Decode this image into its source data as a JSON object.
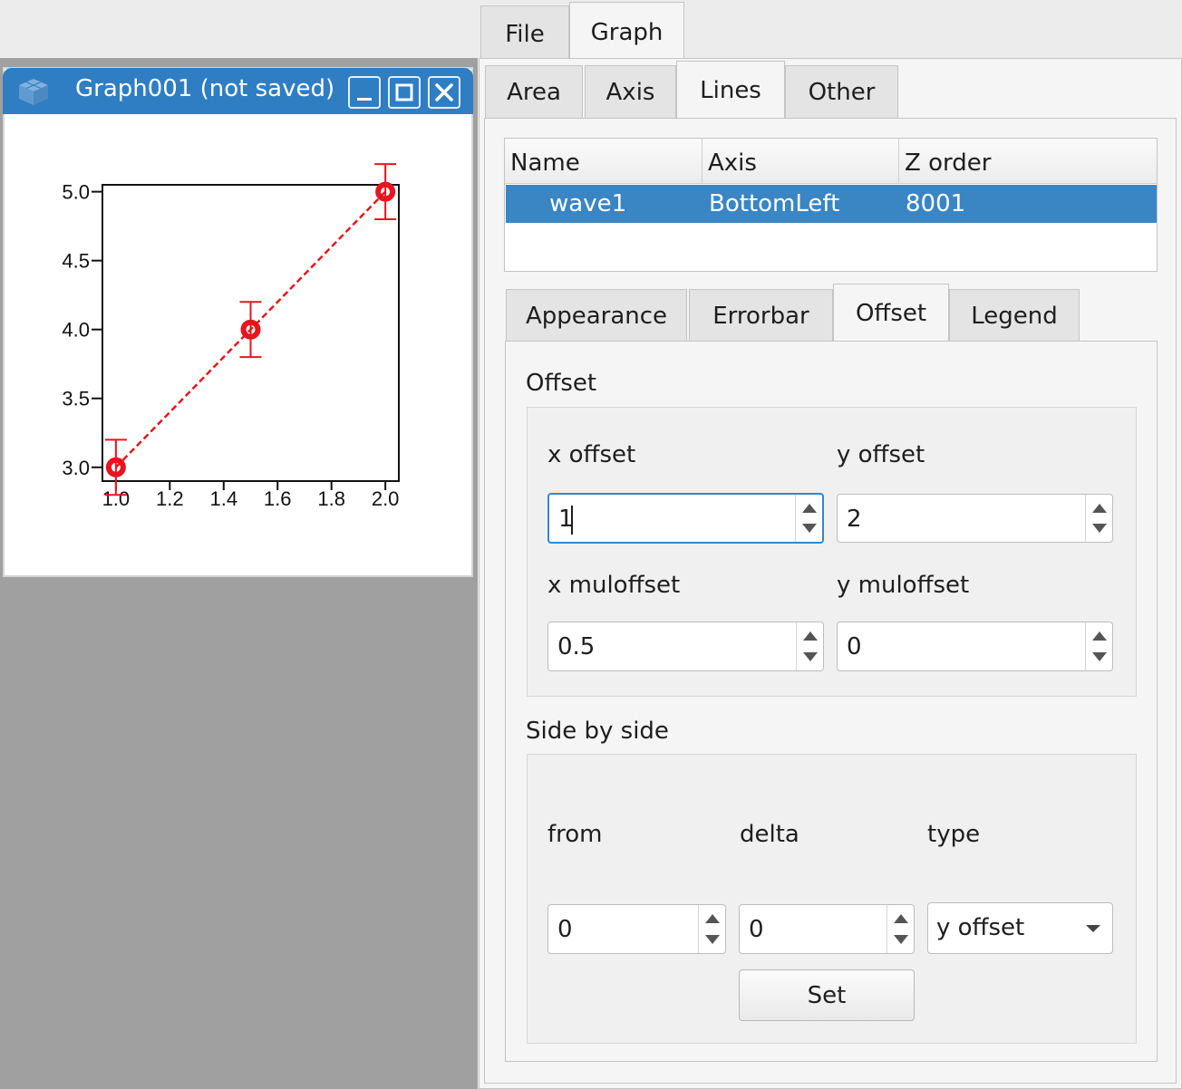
{
  "menu_tabs": [
    "File",
    "Graph"
  ],
  "graph_window": {
    "title": "Graph001 (not saved)",
    "icons": [
      "cube-icon",
      "minimize-icon",
      "maximize-icon",
      "close-icon"
    ]
  },
  "chart_data": {
    "type": "line",
    "title": "",
    "xlabel": "",
    "ylabel": "",
    "xlim": [
      0.95,
      2.05
    ],
    "ylim": [
      2.9,
      5.05
    ],
    "xticks": [
      "1.0",
      "1.2",
      "1.4",
      "1.6",
      "1.8",
      "2.0"
    ],
    "yticks": [
      "3.0",
      "3.5",
      "4.0",
      "4.5",
      "5.0"
    ],
    "series": [
      {
        "x": [
          1.0,
          1.5,
          2.0
        ],
        "y": [
          3.0,
          4.0,
          5.0
        ],
        "yerr": [
          0.2,
          0.2,
          0.2
        ],
        "color": "#e8141e",
        "line_style": "dashed",
        "marker": "circle"
      }
    ]
  },
  "graph_tabs": [
    "Area",
    "Axis",
    "Lines",
    "Other"
  ],
  "lines_table": {
    "headers": [
      "Name",
      "Axis",
      "Z order"
    ],
    "rows": [
      {
        "name": "wave1",
        "axis": "BottomLeft",
        "z_order": "8001"
      }
    ]
  },
  "line_tabs": [
    "Appearance",
    "Errorbar",
    "Offset",
    "Legend"
  ],
  "offset": {
    "group_label": "Offset",
    "x_offset_label": "x offset",
    "y_offset_label": "y offset",
    "x_offset": "1",
    "y_offset": "2",
    "x_muloffset_label": "x muloffset",
    "y_muloffset_label": "y muloffset",
    "x_muloffset": "0.5",
    "y_muloffset": "0"
  },
  "side_by_side": {
    "group_label": "Side by side",
    "from_label": "from",
    "delta_label": "delta",
    "type_label": "type",
    "from": "0",
    "delta": "0",
    "type": "y offset",
    "set_label": "Set"
  },
  "colors": {
    "accent": "#3a85c4",
    "titlebar": "#2f7ec4",
    "plot": "#e8141e",
    "mdi_background": "#a0a0a0"
  }
}
